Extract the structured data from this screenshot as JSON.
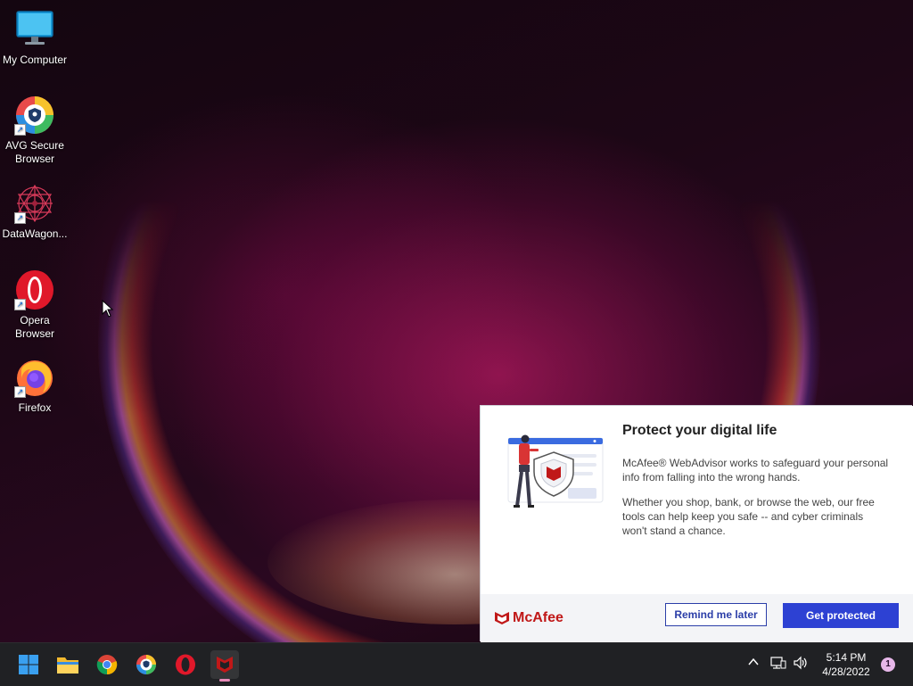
{
  "desktop": {
    "icons": [
      {
        "label": "My Computer",
        "icon": "monitor-icon"
      },
      {
        "label": "AVG Secure Browser",
        "icon": "avg-browser-icon"
      },
      {
        "label": "DataWagon...",
        "icon": "datawagon-icon"
      },
      {
        "label": "Opera Browser",
        "icon": "opera-icon"
      },
      {
        "label": "Firefox",
        "icon": "firefox-icon"
      }
    ]
  },
  "popup": {
    "title": "Protect your digital life",
    "paragraph1": "McAfee® WebAdvisor works to safeguard your personal info from falling into the wrong hands.",
    "paragraph2": "Whether you shop, bank, or browse the web, our free tools can help keep you safe -- and cyber criminals won't stand a chance.",
    "brand": "McAfee",
    "remind_label": "Remind me later",
    "protect_label": "Get protected",
    "colors": {
      "brand_red": "#c01818",
      "primary_blue": "#2d41d3"
    }
  },
  "taskbar": {
    "apps": [
      "start-icon",
      "file-explorer-icon",
      "chrome-icon",
      "avg-browser-icon",
      "opera-icon",
      "mcafee-icon"
    ],
    "active_app": "mcafee-icon",
    "time": "5:14 PM",
    "date": "4/28/2022",
    "notification_count": "1"
  }
}
